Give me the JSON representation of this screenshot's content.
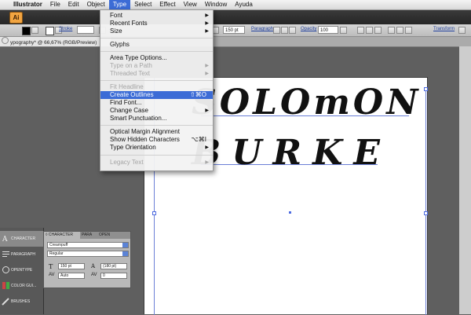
{
  "menubar": {
    "apple": "",
    "items": [
      "Illustrator",
      "File",
      "Edit",
      "Object",
      "Type",
      "Select",
      "Effect",
      "View",
      "Window",
      "Ayuda"
    ],
    "active_index": 4
  },
  "appbar": {
    "logo": "Ai"
  },
  "control_bar": {
    "stroke_label": "Stroke",
    "stroke_field": "",
    "size_value": "150 pt",
    "paragraph_label": "Paragraph",
    "opacity_label": "Opacity",
    "opacity_value": "100",
    "transform_label": "Transform"
  },
  "document_tab": {
    "title": "ypography* @ 66,67% (RGB/Preview)"
  },
  "artboard": {
    "line1": "SOLOmON",
    "line2": "BURKE"
  },
  "type_menu": {
    "items": [
      {
        "label": "Font",
        "submenu": true
      },
      {
        "label": "Recent Fonts",
        "submenu": true
      },
      {
        "label": "Size",
        "submenu": true
      },
      {
        "label": "Glyphs"
      },
      {
        "label": "Area Type Options..."
      },
      {
        "label": "Type on a Path",
        "submenu": true,
        "disabled": true
      },
      {
        "label": "Threaded Text",
        "submenu": true,
        "disabled": true
      },
      {
        "label": "Fit Headline",
        "disabled": true
      },
      {
        "label": "Create Outlines",
        "shortcut": "⇧⌘O",
        "highlighted": true
      },
      {
        "label": "Find Font..."
      },
      {
        "label": "Change Case",
        "submenu": true
      },
      {
        "label": "Smart Punctuation..."
      },
      {
        "label": "Optical Margin Alignment"
      },
      {
        "label": "Show Hidden Characters",
        "shortcut": "⌥⌘I"
      },
      {
        "label": "Type Orientation",
        "submenu": true
      },
      {
        "label": "Legacy Text",
        "submenu": true,
        "disabled": true
      }
    ]
  },
  "dock": {
    "items": [
      {
        "label": "CHARACTER",
        "selected": true
      },
      {
        "label": "PARAGRAPH"
      },
      {
        "label": "OPENTYPE"
      },
      {
        "label": "COLOR GUI..."
      },
      {
        "label": "BRUSHES"
      }
    ]
  },
  "character_panel": {
    "tabs": [
      "◊ CHARACTER",
      "PARA",
      "OPEN"
    ],
    "font_family": "Creampuff",
    "font_style": "Regular",
    "font_size": "150 pt",
    "leading": "(180 pt)",
    "kerning": "Auto",
    "tracking": "0"
  },
  "colors": {
    "menu_highlight": "#3c6cd6",
    "ai_logo": "#f2a541",
    "guide": "#6a7fd6"
  }
}
